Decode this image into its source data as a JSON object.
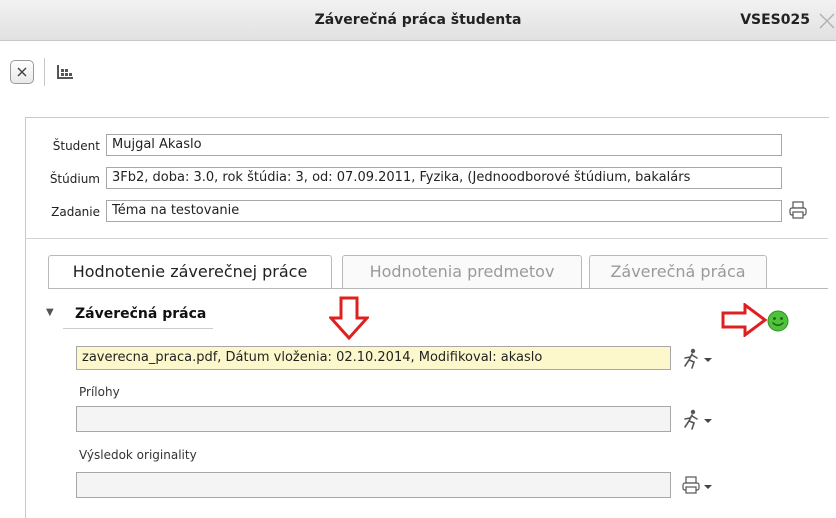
{
  "window": {
    "title": "Záverečná práca študenta",
    "code": "VSES025"
  },
  "student": {
    "student_label": "Študent",
    "student_value": "Mujgal Akaslo",
    "studium_label": "Štúdium",
    "studium_value": "3Fb2, doba: 3.0, rok štúdia: 3, od: 07.09.2011, Fyzika, (Jednoodborové štúdium, bakalárs",
    "zadanie_label": "Zadanie",
    "zadanie_value": "Téma na testovanie"
  },
  "tabs": [
    {
      "label": "Hodnotenie záverečnej práce",
      "active": true
    },
    {
      "label": "Hodnotenia predmetov",
      "active": false
    },
    {
      "label": "Záverečná práca",
      "active": false
    }
  ],
  "section": {
    "title": "Záverečná práca",
    "file_value": "zaverecna_praca.pdf, Dátum vloženia: 02.10.2014, Modifikoval: akaslo",
    "prilohy_label": "Prílohy",
    "prilohy_value": "",
    "originality_label": "Výsledok originality",
    "originality_value": ""
  },
  "colors": {
    "highlight_field": "#fdf8cc",
    "annotation_arrow": "#e02020",
    "status_ok": "#4ec23a"
  },
  "icons": [
    "close-icon",
    "grid-icon",
    "printer-icon",
    "runner-icon",
    "smiley-icon",
    "dropdown-caret-icon"
  ]
}
